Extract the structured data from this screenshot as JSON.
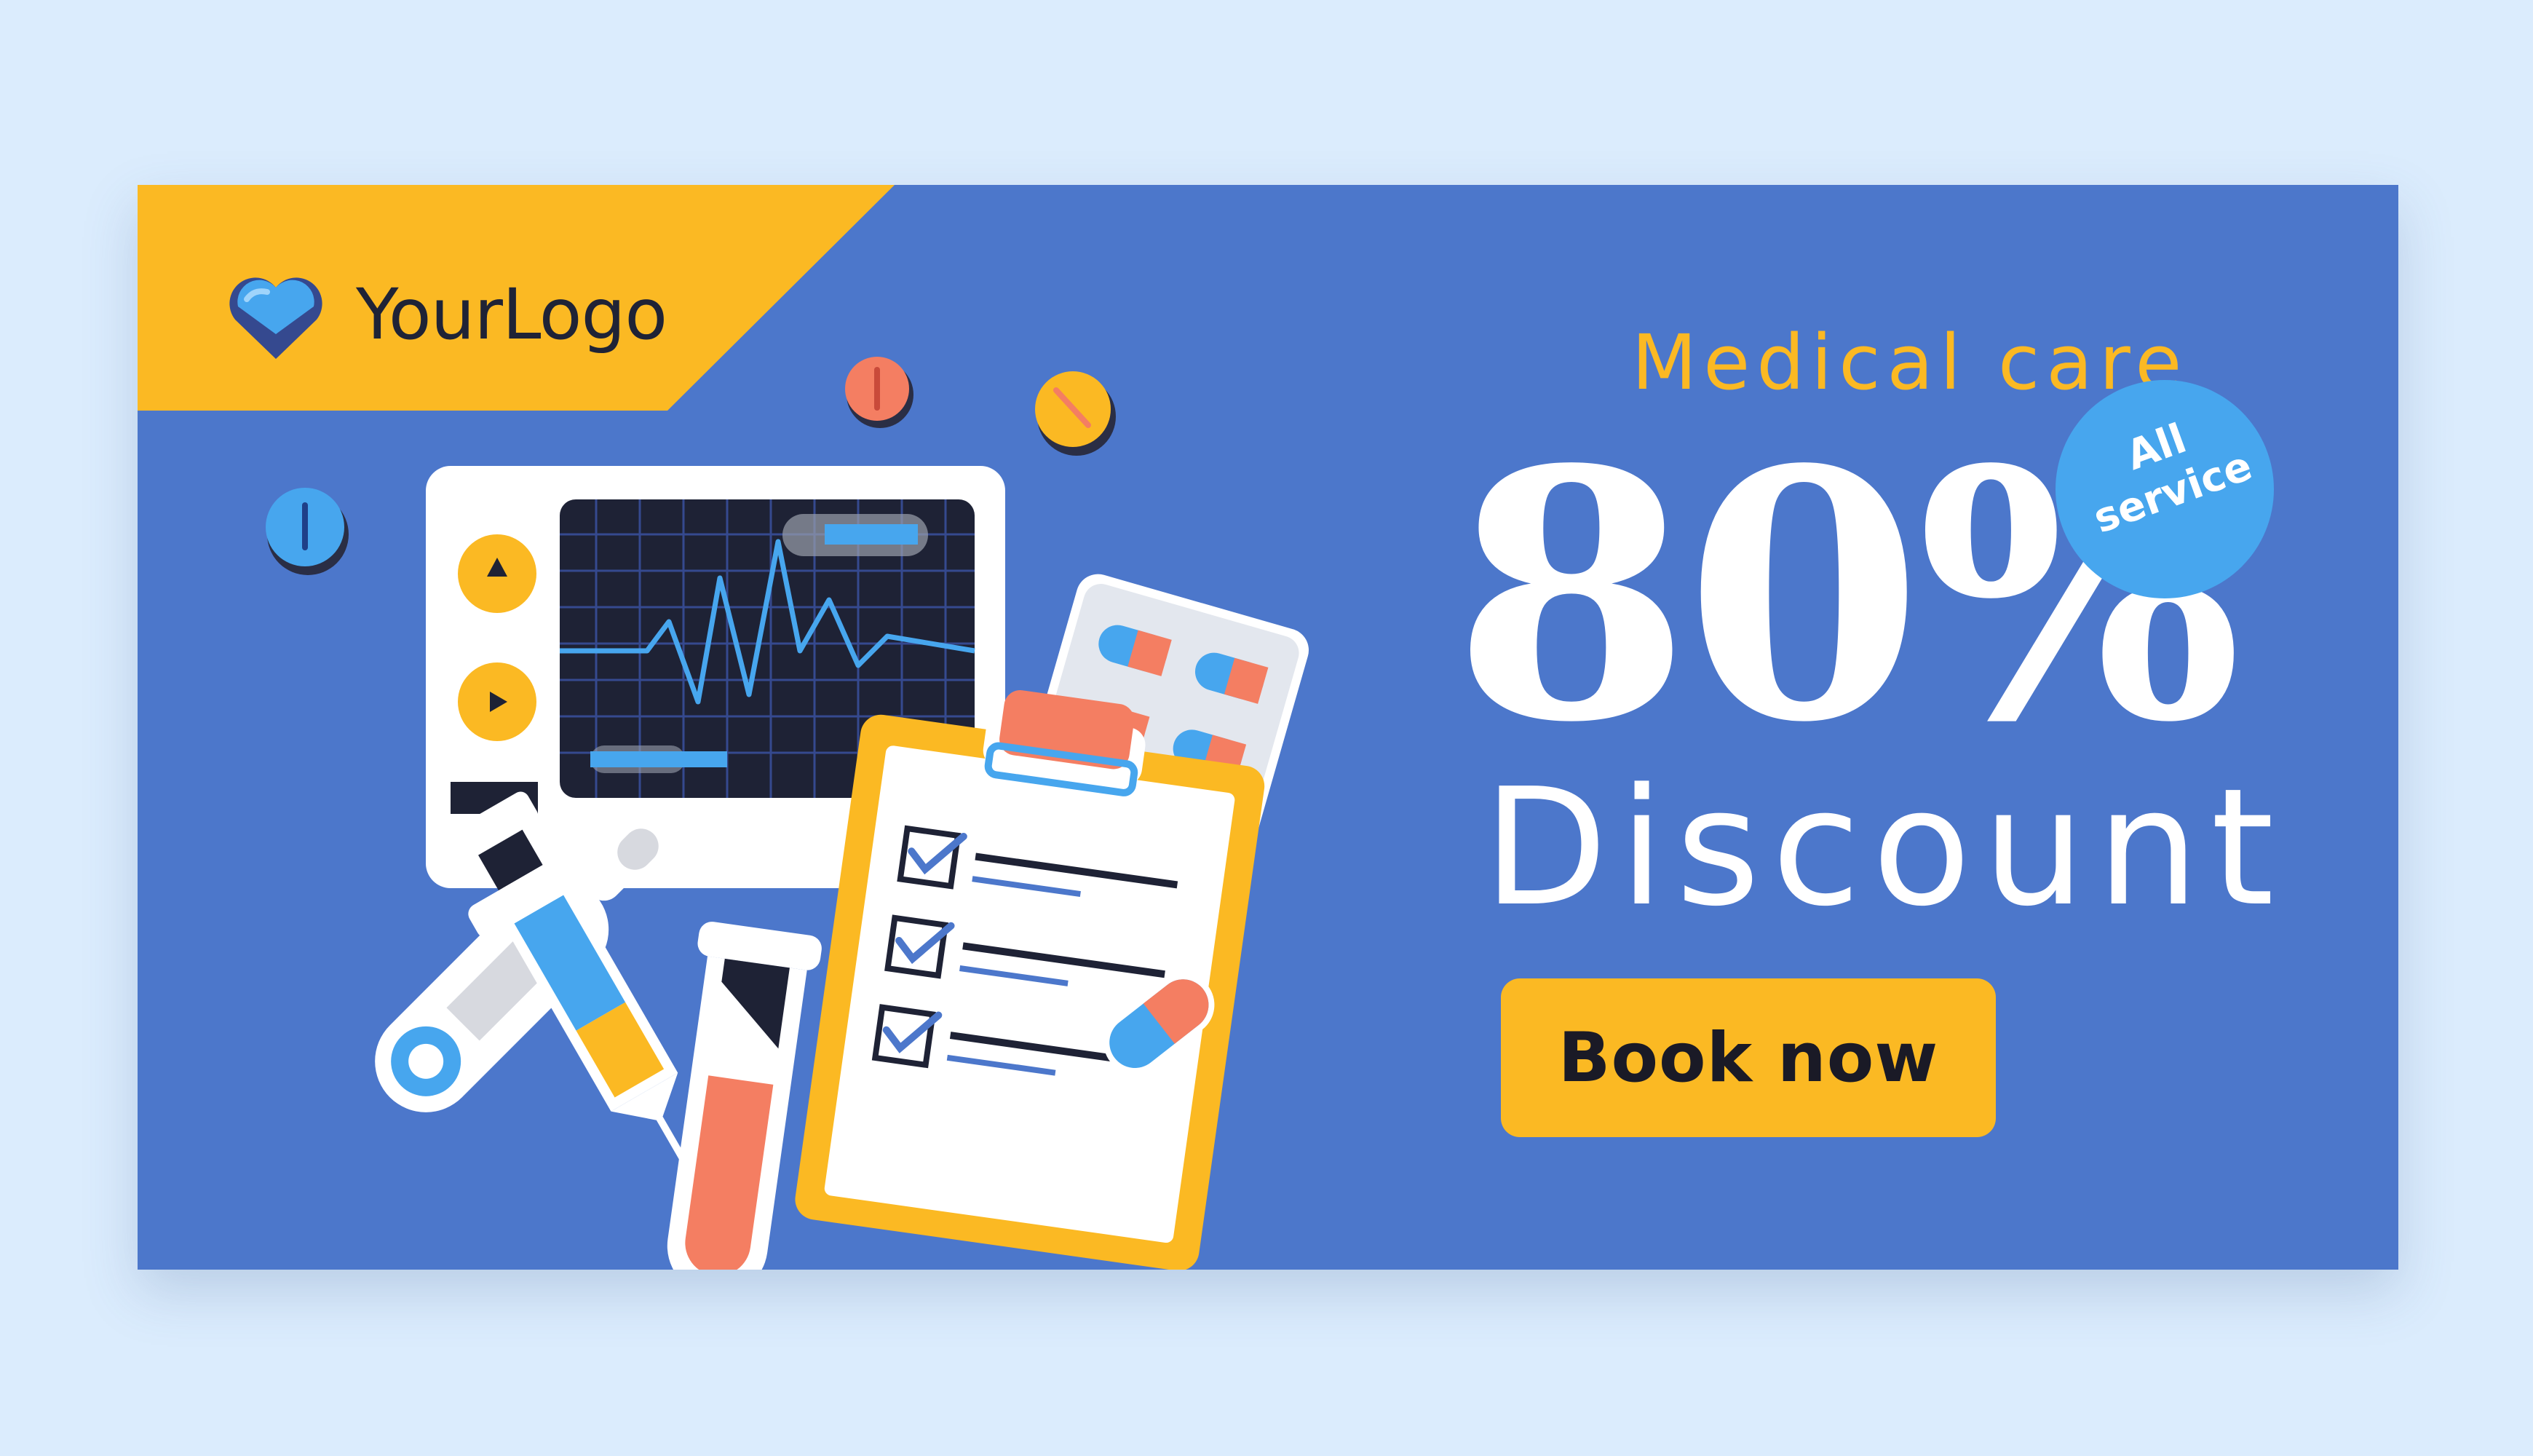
{
  "logo": {
    "text": "YourLogo"
  },
  "promo": {
    "subtitle": "Medical care",
    "percent": "80%",
    "headline": "Discount"
  },
  "badge": {
    "line1": "All",
    "line2": "service"
  },
  "cta": {
    "label": "Book now"
  },
  "colors": {
    "background": "#dbecfd",
    "banner": "#4c77cb",
    "accent_yellow": "#fbb923",
    "badge_blue": "#47a6ee",
    "text_white": "#ffffff",
    "text_dark": "#1a1a26",
    "pill_orange": "#f47e62"
  },
  "illustration": {
    "icons": [
      "heart-logo-icon",
      "heart-monitor-icon",
      "clipboard-checklist-icon",
      "pill-blister-pack-icon",
      "syringe-icon",
      "thermometer-icon",
      "test-tube-icon",
      "capsule-icon",
      "tablet-icon"
    ]
  }
}
